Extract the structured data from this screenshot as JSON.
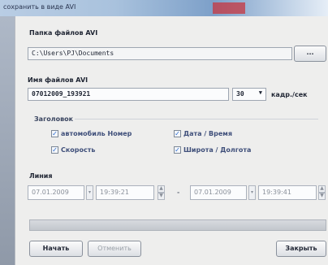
{
  "window": {
    "title": "сохранить в виде AVI"
  },
  "folder": {
    "label": "Папка файлов AVI",
    "path": "C:\\Users\\PJ\\Documents",
    "browse_label": "..."
  },
  "file": {
    "label": "Имя файлов AVI",
    "name": "07012009_193921",
    "fps": "30",
    "fps_unit": "кадр./сек"
  },
  "header_group": {
    "label": "Заголовок",
    "options": [
      {
        "label": "автомобиль Номер",
        "checked": true
      },
      {
        "label": "Дата / Время",
        "checked": true
      },
      {
        "label": "Скорость",
        "checked": true
      },
      {
        "label": "Широта / Долгота",
        "checked": true
      }
    ]
  },
  "range": {
    "label": "Линия",
    "start_date": "07.01.2009",
    "start_time": "19:39:21",
    "separator": "-",
    "end_date": "07.01.2009",
    "end_time": "19:39:41"
  },
  "progress": {
    "value": 0
  },
  "buttons": {
    "start": "Начать",
    "cancel": "Отменить",
    "close": "Закрыть"
  }
}
